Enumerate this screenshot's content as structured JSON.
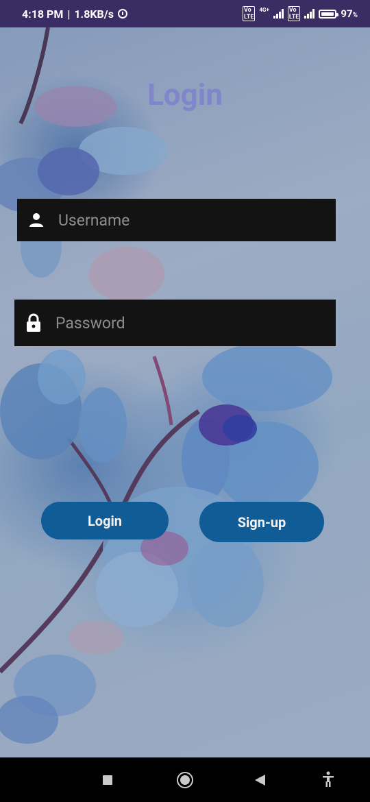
{
  "status_bar": {
    "time": "4:18 PM",
    "speed": "1.8KB/s",
    "volte_1": "Vo LTE",
    "volte_2": "Vo LTE",
    "network_type": "4G+",
    "battery_level": "97",
    "battery_unit": "%"
  },
  "screen": {
    "title": "Login",
    "username_placeholder": "Username",
    "password_placeholder": "Password",
    "login_label": "Login",
    "signup_label": "Sign-up"
  },
  "colors": {
    "status_bar": "#3a2d63",
    "title": "#7f86c9",
    "input_bg": "#131313",
    "button": "#0f5c96",
    "nav_bar": "#000000"
  },
  "icons": {
    "username": "person-icon",
    "password": "lock-icon",
    "nav_recents": "square-icon",
    "nav_home": "circle-icon",
    "nav_back": "triangle-back-icon",
    "accessibility": "accessibility-icon"
  }
}
